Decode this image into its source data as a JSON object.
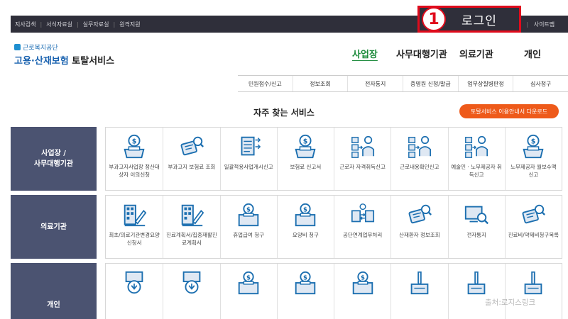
{
  "utility_links": [
    "지사검색",
    "서식자료실",
    "실무자료실",
    "원격지원"
  ],
  "login": {
    "number": "1",
    "label": "로그인"
  },
  "sitemap": "사이트맵",
  "logo": {
    "org": "근로복지공단",
    "line_blue": "고용·산재보험",
    "line_dark": "토탈서비스"
  },
  "gnb": [
    "사업장",
    "사무대행기관",
    "의료기관",
    "개인"
  ],
  "submenu": [
    "민원접수/신고",
    "정보조회",
    "전자통지",
    "증명원 신청/발급",
    "업무상질병판정",
    "심사청구"
  ],
  "section_title": "자주 찾는 서비스",
  "download_button": "토탈서비스 이용안내서 다운로드",
  "rows": [
    {
      "label_lines": [
        "사업장 /",
        "사무대행기관"
      ],
      "items": [
        {
          "label": "부과고지사업장 정산대상자 이의신청",
          "icon": "coin-bank-icon"
        },
        {
          "label": "부과고지 보험료 조회",
          "icon": "search-card-icon"
        },
        {
          "label": "일괄적용사업개시신고",
          "icon": "document-arrows-icon"
        },
        {
          "label": "보험료 신고서",
          "icon": "coin-bank-icon"
        },
        {
          "label": "근로자 자격취득신고",
          "icon": "people-chart-icon"
        },
        {
          "label": "근로내용확인신고",
          "icon": "people-chart-icon"
        },
        {
          "label": "예술인 · 노무제공자 취득신고",
          "icon": "people-chart-icon"
        },
        {
          "label": "노무제공자 월보수액 신고",
          "icon": "coin-bank-icon"
        }
      ]
    },
    {
      "label_lines": [
        "의료기관"
      ],
      "items": [
        {
          "label": "최초/의료기관변경요양신청서",
          "icon": "building-pen-icon"
        },
        {
          "label": "진료계획서/집중재활진료계획서",
          "icon": "building-pen-icon"
        },
        {
          "label": "휴업급여 청구",
          "icon": "coin-box-icon"
        },
        {
          "label": "요양비 청구",
          "icon": "coin-box-icon"
        },
        {
          "label": "공단연계업무처리",
          "icon": "exchange-icon"
        },
        {
          "label": "산재환자 정보조회",
          "icon": "search-card-icon"
        },
        {
          "label": "전자통지",
          "icon": "search-screen-icon"
        },
        {
          "label": "진료비/약제비청구목록",
          "icon": "search-card-icon"
        }
      ]
    },
    {
      "label_lines": [
        "개인"
      ],
      "items": [
        {
          "label": "",
          "icon": "doc-download-icon"
        },
        {
          "label": "",
          "icon": "doc-download-icon"
        },
        {
          "label": "",
          "icon": "coin-box-icon"
        },
        {
          "label": "",
          "icon": "coin-box-icon"
        },
        {
          "label": "",
          "icon": "coin-box-icon"
        },
        {
          "label": "",
          "icon": "pen-doc-icon"
        },
        {
          "label": "",
          "icon": "pen-doc-icon"
        },
        {
          "label": "",
          "icon": "pen-doc-icon"
        }
      ]
    }
  ],
  "credit": "출처:로지스링크",
  "colors": {
    "topbar": "#2f2f3a",
    "highlight": "#e00b1c",
    "row_label": "#4b5371",
    "accent_orange": "#ee5a1a",
    "gnb_active": "#1b8a3a",
    "icon_blue": "#1c6fb0"
  }
}
